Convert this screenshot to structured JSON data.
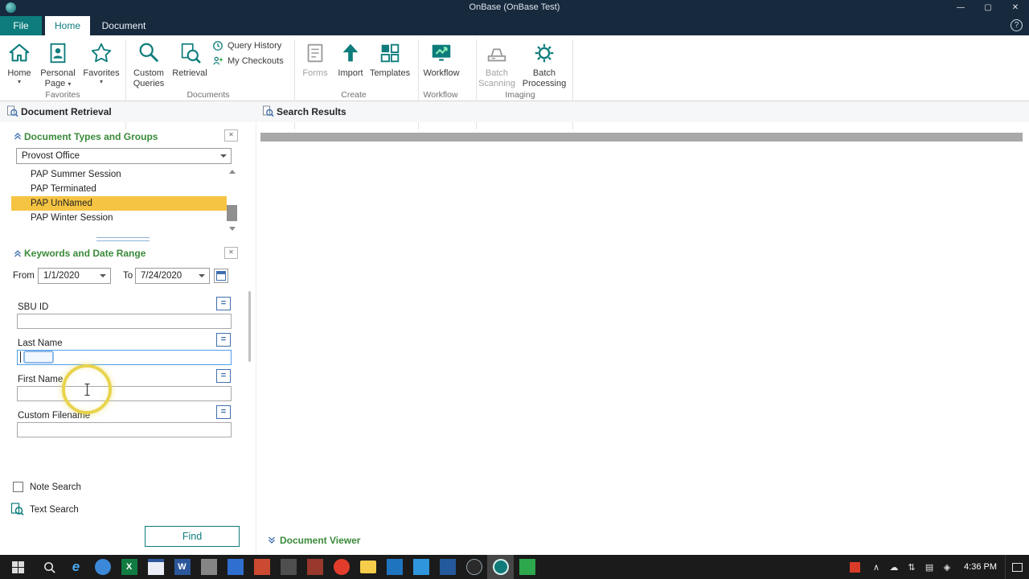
{
  "colors": {
    "accent": "#0e7c7c",
    "titlebar": "#17293d",
    "green-header": "#3a8a3a",
    "selection-yellow": "#f6c443",
    "taskbar": "#1b1b1b",
    "click-ring": "#e8d44c"
  },
  "icons": {
    "dropdown_caret": "▾"
  },
  "titlebar": {
    "title": "OnBase (OnBase Test)",
    "minimize": "—",
    "maximize": "▢",
    "close": "✕"
  },
  "tabs": {
    "file": "File",
    "home": "Home",
    "document": "Document",
    "help": "?"
  },
  "ribbon": {
    "home": "Home",
    "personal_page": "Personal Page",
    "favorites_btn": "Favorites",
    "custom_queries": "Custom Queries",
    "retrieval": "Retrieval",
    "query_history": "Query History",
    "my_checkouts": "My Checkouts",
    "forms": "Forms",
    "import": "Import",
    "templates": "Templates",
    "workflow_btn": "Workflow",
    "batch_scanning": "Batch Scanning",
    "batch_processing": "Batch Processing",
    "groups": {
      "favorites": "Favorites",
      "documents": "Documents",
      "create": "Create",
      "workflow": "Workflow",
      "imaging": "Imaging"
    }
  },
  "retrieval_panel": {
    "title": "Document Retrieval",
    "doc_types": {
      "header": "Document Types and Groups",
      "group_value": "Provost Office",
      "items": [
        {
          "label": "PAP Summer Session",
          "selected": false
        },
        {
          "label": "PAP Terminated",
          "selected": false
        },
        {
          "label": "PAP UnNamed",
          "selected": true
        },
        {
          "label": "PAP Winter Session",
          "selected": false
        }
      ]
    },
    "keywords": {
      "header": "Keywords and Date Range",
      "from_label": "From",
      "from_value": "1/1/2020",
      "to_label": "To",
      "to_value": "7/24/2020",
      "operator": "=",
      "fields": [
        {
          "label": "SBU ID",
          "value": ""
        },
        {
          "label": "Last Name",
          "value": ""
        },
        {
          "label": "First Name",
          "value": ""
        },
        {
          "label": "Custom Filename",
          "value": ""
        }
      ]
    },
    "note_search": "Note Search",
    "text_search": "Text Search",
    "find": "Find"
  },
  "results_panel": {
    "title": "Search Results",
    "viewer": "Document Viewer"
  },
  "taskbar": {
    "time": "4:36 PM",
    "apps": [
      {
        "glyph": "e",
        "style": "color:#4aa9f2;font-style:italic;font-size:17px"
      },
      {
        "glyph": "",
        "style": "background:#3b88d8;border-radius:50%"
      },
      {
        "glyph": "X",
        "style": "background:#107c41;color:#fff;font-size:11px"
      },
      {
        "glyph": "",
        "style": "background:#e9eef6;border-top:4px solid #2b579a"
      },
      {
        "glyph": "W",
        "style": "background:#2b579a;color:#fff;font-size:11px"
      },
      {
        "glyph": "",
        "style": "background:#858585"
      },
      {
        "glyph": "",
        "style": "background:#2f6fd0"
      },
      {
        "glyph": "",
        "style": "background:#cc4a31"
      },
      {
        "glyph": "",
        "style": "background:#4f4f4f"
      },
      {
        "glyph": "",
        "style": "background:#99382c"
      },
      {
        "glyph": "",
        "style": "background:#e23d2c;border-radius:50%"
      },
      {
        "glyph": "",
        "style": "background:#f6cd4a;border-radius:2px;height:16px"
      },
      {
        "glyph": "",
        "style": "background:#1f74c0"
      },
      {
        "glyph": "",
        "style": "background:#2f95dd"
      },
      {
        "glyph": "",
        "style": "background:#24599c"
      },
      {
        "glyph": "",
        "style": "background:#2b2b2b;border:1px solid #8fa0a8;border-radius:50%"
      },
      {
        "glyph": "",
        "style": "background:#0f7b7b;border-radius:50%;box-shadow:inset 0 0 0 2px rgba(255,255,255,.85), inset 0 0 0 5px #0f7b7b"
      },
      {
        "glyph": "",
        "style": "background:#2da84d"
      }
    ],
    "tray": [
      {
        "glyph": "∧"
      },
      {
        "glyph": "☁"
      },
      {
        "glyph": "⇅"
      },
      {
        "glyph": "▤"
      },
      {
        "glyph": "◈"
      }
    ]
  }
}
